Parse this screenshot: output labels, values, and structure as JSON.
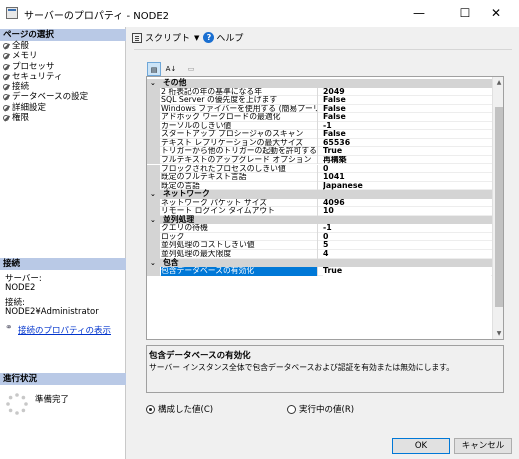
{
  "window": {
    "title": "サーバーのプロパティ - NODE2",
    "minimize": "—",
    "maximize": "☐",
    "close": "✕"
  },
  "sidebar": {
    "pages_header": "ページの選択",
    "items": [
      {
        "label": "全般"
      },
      {
        "label": "メモリ"
      },
      {
        "label": "プロセッサ"
      },
      {
        "label": "セキュリティ"
      },
      {
        "label": "接続"
      },
      {
        "label": "データベースの設定"
      },
      {
        "label": "詳細設定"
      },
      {
        "label": "権限"
      }
    ],
    "connection_header": "接続",
    "server_label": "サーバー:",
    "server_value": "NODE2",
    "connection_label": "接続:",
    "connection_value": "NODE2¥Administrator",
    "view_connection_link": "接続のプロパティの表示",
    "progress_header": "進行状況",
    "progress_status": "準備完了"
  },
  "toolbar": {
    "script_label": "スクリプト",
    "help_label": "ヘルプ"
  },
  "grid_toolbar": {
    "categorized": "▤",
    "alphabetical": "A↓",
    "pages": "▭"
  },
  "property_grid": {
    "rows": [
      {
        "type": "category",
        "label": "その他",
        "toggle": "⌄"
      },
      {
        "type": "property",
        "name": "2 桁表記の年の基準になる年",
        "value": "2049"
      },
      {
        "type": "property",
        "name": "SQL Server の優先度を上げます",
        "value": "False"
      },
      {
        "type": "property",
        "name": "Windows ファイバーを使用する (簡易プーリング)",
        "value": "False"
      },
      {
        "type": "property",
        "name": "アドホック ワークロードの最適化",
        "value": "False"
      },
      {
        "type": "property",
        "name": "カーソルのしきい値",
        "value": "-1"
      },
      {
        "type": "property",
        "name": "スタートアップ プロシージャのスキャン",
        "value": "False"
      },
      {
        "type": "property",
        "name": "テキスト レプリケーションの最大サイズ",
        "value": "65536"
      },
      {
        "type": "property",
        "name": "トリガーから他のトリガーの起動を許可する",
        "value": "True"
      },
      {
        "type": "property",
        "name": "フルテキストのアップグレード オプション",
        "value": "再構築"
      },
      {
        "type": "property",
        "name": "ブロックされたプロセスのしきい値",
        "value": "0"
      },
      {
        "type": "property",
        "name": "既定のフルテキスト言語",
        "value": "1041"
      },
      {
        "type": "property",
        "name": "既定の言語",
        "value": "Japanese"
      },
      {
        "type": "category",
        "label": "ネットワーク",
        "toggle": "⌄"
      },
      {
        "type": "property",
        "name": "ネットワーク パケット サイズ",
        "value": "4096"
      },
      {
        "type": "property",
        "name": "リモート ログイン タイムアウト",
        "value": "10"
      },
      {
        "type": "category",
        "label": "並列処理",
        "toggle": "⌄"
      },
      {
        "type": "property",
        "name": "クエリの待機",
        "value": "-1"
      },
      {
        "type": "property",
        "name": "ロック",
        "value": "0"
      },
      {
        "type": "property",
        "name": "並列処理のコストしきい値",
        "value": "5"
      },
      {
        "type": "property",
        "name": "並列処理の最大限度",
        "value": "4"
      },
      {
        "type": "category",
        "label": "包含",
        "toggle": "⌄"
      },
      {
        "type": "property",
        "name": "包含データベースの有効化",
        "value": "True",
        "selected": true
      }
    ],
    "scroll_up": "▲",
    "scroll_down": "▼"
  },
  "description": {
    "title": "包含データベースの有効化",
    "text": "サーバー インスタンス全体で包含データベースおよび認証を有効または無効にします。"
  },
  "options": {
    "configured_label": "構成した値(C)",
    "running_label": "実行中の値(R)",
    "selected": "configured"
  },
  "buttons": {
    "ok": "OK",
    "cancel": "キャンセル"
  },
  "colors": {
    "selection": "#0078d7",
    "section_header": "#b9c9e6",
    "link": "#0033cc"
  }
}
